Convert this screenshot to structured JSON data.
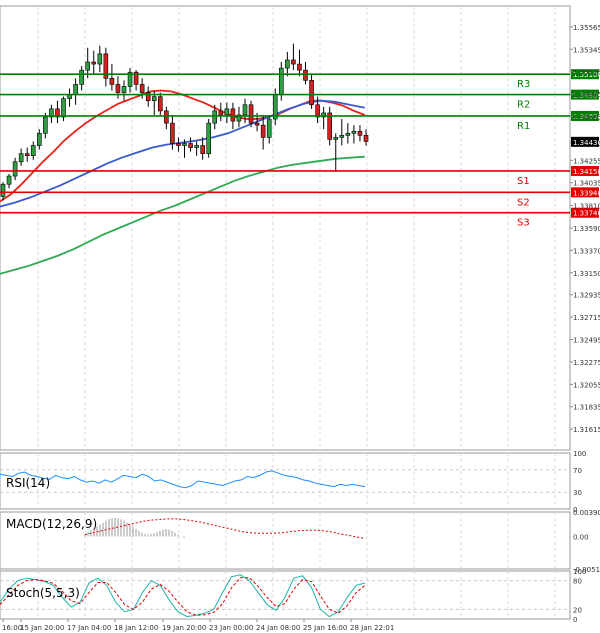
{
  "chart_data": [
    {
      "panel": "main",
      "type": "candlestick",
      "y_ticks": [
        1.35565,
        1.35345,
        1.35125,
        1.34905,
        1.34685,
        1.34425,
        1.34255,
        1.34035,
        1.3381,
        1.3359,
        1.3337,
        1.3315,
        1.32935,
        1.32715,
        1.32495,
        1.32275,
        1.32055,
        1.31835,
        1.31615
      ],
      "y_tick_labels": [
        "1.35565",
        "1.35345",
        "1.35125",
        "1.34905",
        "1.34685",
        "1.34425",
        "1.34255",
        "1.34035",
        "1.33810",
        "1.33590",
        "1.33370",
        "1.33150",
        "1.32935",
        "1.32715",
        "1.32495",
        "1.32275",
        "1.32055",
        "1.31835",
        "1.31615"
      ],
      "ylim": [
        1.3141,
        1.3577
      ],
      "x_tick_labels": [
        "16:00",
        "15 Jan 20:00",
        "17 Jan 04:00",
        "18 Jan 12:00",
        "19 Jan 20:00",
        "23 Jan 00:00",
        "24 Jan 08:00",
        "25 Jan 16:00",
        "28 Jan 22:01"
      ],
      "current_price": 1.34436,
      "current_price_label": "1.34436",
      "levels": [
        {
          "name": "R3",
          "value": 1.351,
          "label": "1.35100",
          "color": "#008000"
        },
        {
          "name": "R2",
          "value": 1.349,
          "label": "1.34900",
          "color": "#008000"
        },
        {
          "name": "R1",
          "value": 1.3469,
          "label": "1.34690",
          "color": "#008000"
        },
        {
          "name": "S1",
          "value": 1.3415,
          "label": "1.34150",
          "color": "#e00000"
        },
        {
          "name": "S2",
          "value": 1.3394,
          "label": "1.33940",
          "color": "#e00000"
        },
        {
          "name": "S3",
          "value": 1.3374,
          "label": "1.33740",
          "color": "#e00000"
        }
      ],
      "candles": [
        [
          1.339,
          1.3404,
          1.3386,
          1.3402
        ],
        [
          1.3402,
          1.3412,
          1.3398,
          1.341
        ],
        [
          1.341,
          1.3428,
          1.3406,
          1.3424
        ],
        [
          1.3424,
          1.3437,
          1.342,
          1.3432
        ],
        [
          1.3432,
          1.3438,
          1.3424,
          1.343
        ],
        [
          1.343,
          1.3444,
          1.3426,
          1.344
        ],
        [
          1.344,
          1.3456,
          1.3436,
          1.3452
        ],
        [
          1.3452,
          1.3472,
          1.3447,
          1.3468
        ],
        [
          1.3468,
          1.348,
          1.3462,
          1.3476
        ],
        [
          1.3476,
          1.3484,
          1.3462,
          1.3468
        ],
        [
          1.3468,
          1.3488,
          1.3464,
          1.3486
        ],
        [
          1.3486,
          1.3496,
          1.3478,
          1.349
        ],
        [
          1.349,
          1.3506,
          1.348,
          1.35
        ],
        [
          1.35,
          1.3518,
          1.3494,
          1.3514
        ],
        [
          1.3514,
          1.3536,
          1.3506,
          1.3522
        ],
        [
          1.3522,
          1.3533,
          1.351,
          1.352
        ],
        [
          1.352,
          1.3538,
          1.3512,
          1.353
        ],
        [
          1.353,
          1.3536,
          1.3498,
          1.3506
        ],
        [
          1.3506,
          1.352,
          1.3494,
          1.35
        ],
        [
          1.35,
          1.3508,
          1.3486,
          1.3492
        ],
        [
          1.3492,
          1.3504,
          1.3484,
          1.3498
        ],
        [
          1.3498,
          1.3516,
          1.3492,
          1.3512
        ],
        [
          1.3512,
          1.3514,
          1.3494,
          1.35
        ],
        [
          1.35,
          1.3506,
          1.3486,
          1.3492
        ],
        [
          1.3492,
          1.3498,
          1.3478,
          1.3484
        ],
        [
          1.3484,
          1.3494,
          1.347,
          1.3488
        ],
        [
          1.3488,
          1.3492,
          1.347,
          1.3474
        ],
        [
          1.3474,
          1.3478,
          1.3456,
          1.3462
        ],
        [
          1.3462,
          1.347,
          1.3436,
          1.3442
        ],
        [
          1.3442,
          1.3448,
          1.3434,
          1.344
        ],
        [
          1.344,
          1.3446,
          1.3428,
          1.3442
        ],
        [
          1.3442,
          1.3448,
          1.3434,
          1.3438
        ],
        [
          1.3438,
          1.3444,
          1.343,
          1.344
        ],
        [
          1.344,
          1.3448,
          1.3426,
          1.3432
        ],
        [
          1.3432,
          1.3466,
          1.3428,
          1.3462
        ],
        [
          1.3462,
          1.348,
          1.3456,
          1.3474
        ],
        [
          1.3474,
          1.3482,
          1.3464,
          1.347
        ],
        [
          1.347,
          1.3482,
          1.3462,
          1.3476
        ],
        [
          1.3476,
          1.3482,
          1.3456,
          1.3464
        ],
        [
          1.3464,
          1.3478,
          1.3458,
          1.347
        ],
        [
          1.347,
          1.3486,
          1.3462,
          1.348
        ],
        [
          1.348,
          1.3484,
          1.3458,
          1.3462
        ],
        [
          1.3462,
          1.3472,
          1.3454,
          1.346
        ],
        [
          1.346,
          1.347,
          1.3436,
          1.3448
        ],
        [
          1.3448,
          1.347,
          1.3442,
          1.3466
        ],
        [
          1.3466,
          1.3496,
          1.346,
          1.349
        ],
        [
          1.349,
          1.3522,
          1.3484,
          1.3516
        ],
        [
          1.3516,
          1.3532,
          1.3508,
          1.3524
        ],
        [
          1.3524,
          1.354,
          1.3514,
          1.352
        ],
        [
          1.352,
          1.3534,
          1.3508,
          1.3514
        ],
        [
          1.3514,
          1.3522,
          1.35,
          1.3504
        ],
        [
          1.3504,
          1.351,
          1.3476,
          1.348
        ],
        [
          1.348,
          1.3488,
          1.3462,
          1.3468
        ],
        [
          1.3468,
          1.3478,
          1.3456,
          1.3472
        ],
        [
          1.3472,
          1.3478,
          1.344,
          1.3446
        ],
        [
          1.3446,
          1.3452,
          1.3414,
          1.3448
        ],
        [
          1.3448,
          1.3466,
          1.344,
          1.345
        ],
        [
          1.345,
          1.3462,
          1.3442,
          1.3452
        ],
        [
          1.3452,
          1.346,
          1.3442,
          1.3454
        ],
        [
          1.3454,
          1.346,
          1.3444,
          1.345
        ],
        [
          1.345,
          1.3456,
          1.344,
          1.3444
        ]
      ],
      "ma": [
        {
          "color": "#e8221a",
          "values": [
            1.3385,
            1.3392,
            1.3402,
            1.3413,
            1.3424,
            1.3434,
            1.3445,
            1.3454,
            1.3462,
            1.3469,
            1.3475,
            1.3481,
            1.3485,
            1.3489,
            1.3493,
            1.3494,
            1.3493,
            1.349,
            1.3486,
            1.3482,
            1.3477,
            1.3472,
            1.3468,
            1.3466,
            1.3466,
            1.3468,
            1.3471,
            1.3476,
            1.348,
            1.3484,
            1.3484,
            1.3482,
            1.3479,
            1.3474,
            1.347
          ]
        },
        {
          "color": "#3a5bd0",
          "values": [
            1.338,
            1.3384,
            1.3389,
            1.3395,
            1.3401,
            1.3408,
            1.3415,
            1.3422,
            1.3428,
            1.3433,
            1.3438,
            1.3441,
            1.3443,
            1.3445,
            1.3448,
            1.3452,
            1.3458,
            1.3464,
            1.347,
            1.3476,
            1.3481,
            1.3484,
            1.3483,
            1.348,
            1.3477
          ]
        },
        {
          "color": "#2eaa50",
          "values": [
            1.3314,
            1.3318,
            1.3322,
            1.3327,
            1.3332,
            1.3338,
            1.3345,
            1.3352,
            1.3358,
            1.3364,
            1.337,
            1.3376,
            1.3381,
            1.3387,
            1.3393,
            1.3399,
            1.3405,
            1.341,
            1.3414,
            1.3418,
            1.3421,
            1.3423,
            1.3425,
            1.3427,
            1.3428,
            1.3429
          ]
        }
      ]
    },
    {
      "panel": "rsi",
      "type": "line",
      "label": "RSI(14)",
      "ylim": [
        0,
        100
      ],
      "y_tick_labels": [
        "100",
        "70",
        "30",
        "0"
      ],
      "line_color": "#1e90ff",
      "values": [
        62,
        60,
        58,
        64,
        66,
        60,
        58,
        55,
        53,
        60,
        56,
        54,
        58,
        52,
        48,
        50,
        46,
        52,
        48,
        54,
        60,
        58,
        56,
        62,
        58,
        50,
        52,
        48,
        44,
        40,
        38,
        42,
        50,
        48,
        46,
        44,
        42,
        46,
        50,
        52,
        58,
        56,
        60,
        66,
        68,
        64,
        60,
        58,
        56,
        52,
        50,
        46,
        44,
        42,
        40,
        44,
        42,
        44,
        42,
        40
      ]
    },
    {
      "panel": "macd",
      "type": "bar+line",
      "label": "MACD(12,26,9)",
      "ylim": [
        -0.00518,
        0.0039
      ],
      "y_tick_labels": [
        "0.003904",
        "0.00",
        "-0.005182"
      ],
      "histogram": [
        0.0004,
        0.0007,
        0.001,
        0.0013,
        0.0016,
        0.0019,
        0.0022,
        0.0025,
        0.0028,
        0.0029,
        0.003,
        0.0029,
        0.0027,
        0.0025,
        0.0022,
        0.0019,
        0.0016,
        0.0012,
        0.0009,
        0.0006,
        0.0004,
        0.0003,
        0.0004,
        0.0005,
        0.0007,
        0.0009,
        0.0011,
        0.0012,
        0.0011,
        0.0009,
        0.0006,
        0.0003,
        0.0,
        -0.0002
      ],
      "signal": [
        0.0003,
        0.0006,
        0.0009,
        0.0012,
        0.0015,
        0.0018,
        0.0021,
        0.0024,
        0.0026,
        0.0027,
        0.0028,
        0.0028,
        0.0027,
        0.0025,
        0.0023,
        0.002,
        0.0017,
        0.0014,
        0.0011,
        0.0008,
        0.0006,
        0.0005,
        0.0005,
        0.0005,
        0.0006,
        0.0008,
        0.0009,
        0.001,
        0.001,
        0.0009,
        0.0007,
        0.0004,
        0.0002,
        -0.0001,
        -0.0003
      ]
    },
    {
      "panel": "stoch",
      "type": "line",
      "label": "Stoch(5,5,3)",
      "ylim": [
        0,
        100
      ],
      "y_tick_labels": [
        "100",
        "80",
        "20",
        "0"
      ],
      "main_color": "#20b2aa",
      "signal_color": "#e00000",
      "main": [
        35,
        62,
        80,
        85,
        82,
        78,
        70,
        45,
        25,
        35,
        75,
        85,
        70,
        35,
        15,
        20,
        55,
        80,
        70,
        40,
        15,
        5,
        8,
        12,
        20,
        55,
        88,
        92,
        80,
        55,
        30,
        18,
        45,
        85,
        90,
        65,
        20,
        5,
        15,
        45,
        70,
        75
      ],
      "signal": [
        30,
        50,
        70,
        80,
        82,
        80,
        74,
        58,
        38,
        32,
        55,
        76,
        76,
        55,
        30,
        20,
        35,
        62,
        72,
        58,
        35,
        15,
        8,
        9,
        14,
        32,
        65,
        86,
        86,
        68,
        45,
        26,
        32,
        62,
        82,
        78,
        48,
        20,
        12,
        28,
        55,
        70
      ]
    }
  ]
}
